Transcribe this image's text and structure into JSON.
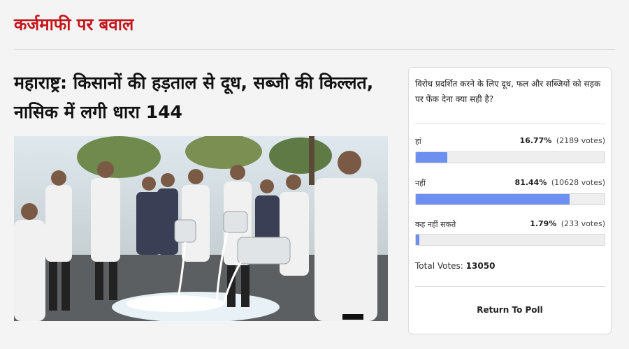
{
  "section": {
    "title": "कर्जमाफी पर बवाल"
  },
  "article": {
    "headline": "महाराष्ट्र: किसानों की हड़ताल से दूध, सब्जी की किल्लत, नासिक में लगी धारा 144"
  },
  "poll": {
    "question": "विरोध प्रदर्शित करने के लिए दूध, फल और सब्जियों को सड़क पर फेंक देना क्या सही है?",
    "options": [
      {
        "label": "हां",
        "percent_text": "16.77%",
        "votes_text": "(2189 votes)",
        "fraction": 0.1677
      },
      {
        "label": "नहीं",
        "percent_text": "81.44%",
        "votes_text": "(10628 votes)",
        "fraction": 0.8144
      },
      {
        "label": "कह नहीं सकते",
        "percent_text": "1.79%",
        "votes_text": "(233 votes)",
        "fraction": 0.0179
      }
    ],
    "total_label": "Total Votes:",
    "total_value": "13050",
    "return_label": "Return To Poll",
    "bar_color": "#6c8ff0"
  },
  "colors": {
    "accent": "#c4161c"
  }
}
